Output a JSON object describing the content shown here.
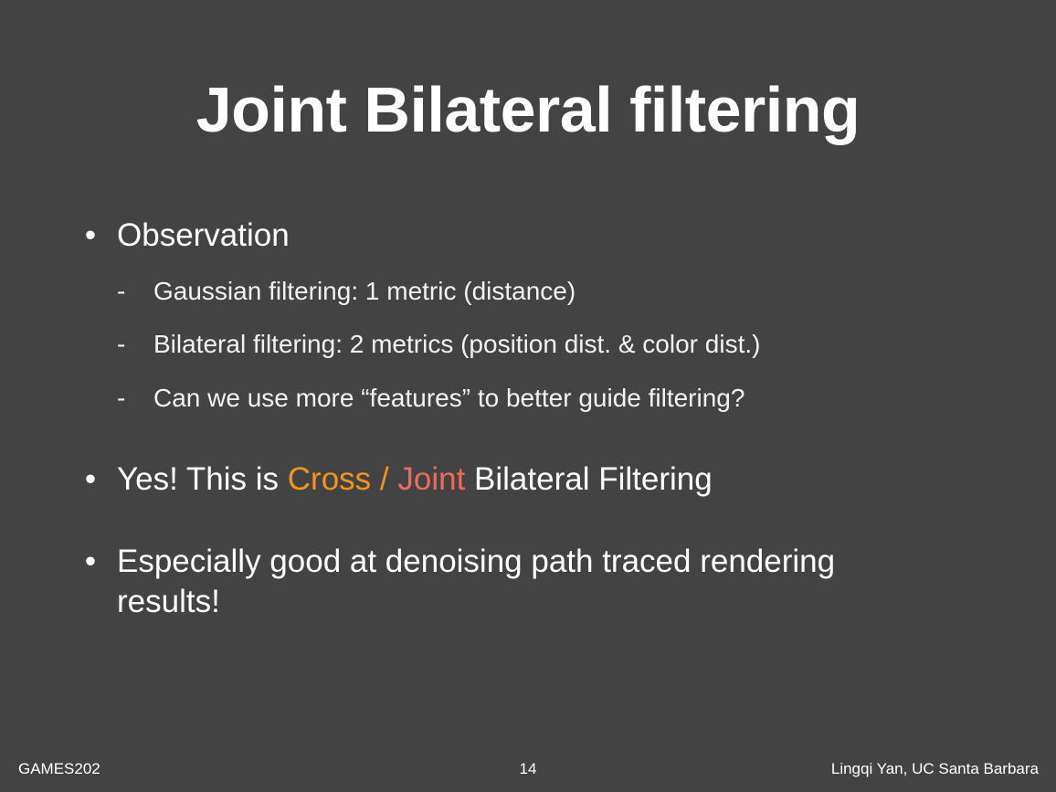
{
  "slide": {
    "title": "Joint Bilateral filtering",
    "bullets": [
      {
        "marker": "•",
        "text": "Observation",
        "subitems": [
          {
            "marker": "-",
            "text": "Gaussian filtering: 1 metric (distance)"
          },
          {
            "marker": "-",
            "text": "Bilateral filtering: 2 metrics (position dist. & color dist.)"
          },
          {
            "marker": "-",
            "text": "Can we use more “features” to better guide filtering?"
          }
        ]
      },
      {
        "marker": "•",
        "text_parts": [
          "Yes! This is ",
          "Cross",
          " / ",
          "Joint",
          " Bilateral Filtering"
        ]
      },
      {
        "marker": "•",
        "text": "Especially good at denoising path traced rendering results!"
      }
    ]
  },
  "footer": {
    "left": "GAMES202",
    "page_number": "14",
    "right": "Lingqi Yan, UC Santa Barbara"
  },
  "colors": {
    "background": "#434343",
    "text": "#ffffff",
    "cross_highlight": "#f6921e",
    "joint_highlight": "#f06b5b"
  }
}
